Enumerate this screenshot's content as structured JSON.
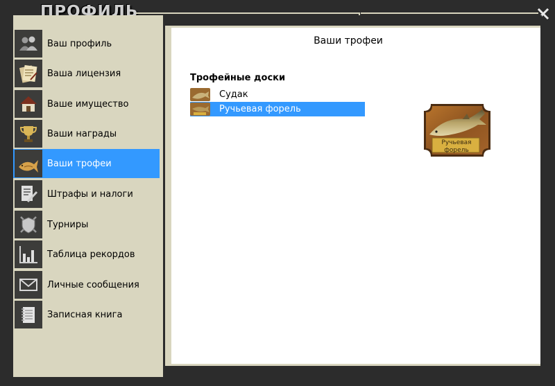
{
  "window": {
    "title": "ПРОФИЛЬ",
    "close_icon": "close-x-icon"
  },
  "sidebar": {
    "items": [
      {
        "label": "Ваш профиль",
        "icon": "users-icon"
      },
      {
        "label": "Ваша лицензия",
        "icon": "license-icon"
      },
      {
        "label": "Ваше имущество",
        "icon": "house-icon"
      },
      {
        "label": "Ваши награды",
        "icon": "cup-icon"
      },
      {
        "label": "Ваши трофеи",
        "icon": "fish-trophy-icon"
      },
      {
        "label": "Штрафы и налоги",
        "icon": "document-pen-icon"
      },
      {
        "label": "Турниры",
        "icon": "shield-swords-icon"
      },
      {
        "label": "Таблица рекордов",
        "icon": "bar-chart-icon"
      },
      {
        "label": "Личные сообщения",
        "icon": "envelope-icon"
      },
      {
        "label": "Записная книга",
        "icon": "notebook-icon"
      }
    ],
    "active_index": 4,
    "active_color": "#3399ff"
  },
  "main": {
    "title": "Ваши трофеи",
    "section_title": "Трофейные доски",
    "trophies": [
      {
        "label": "Судак",
        "selected": false
      },
      {
        "label": "Ручьевая форель",
        "selected": true
      }
    ],
    "preview": {
      "caption": "Ручьевая форель"
    }
  },
  "colors": {
    "background": "#2c2c2c",
    "panel_beige": "#d9d6bf",
    "selection": "#3399ff"
  }
}
